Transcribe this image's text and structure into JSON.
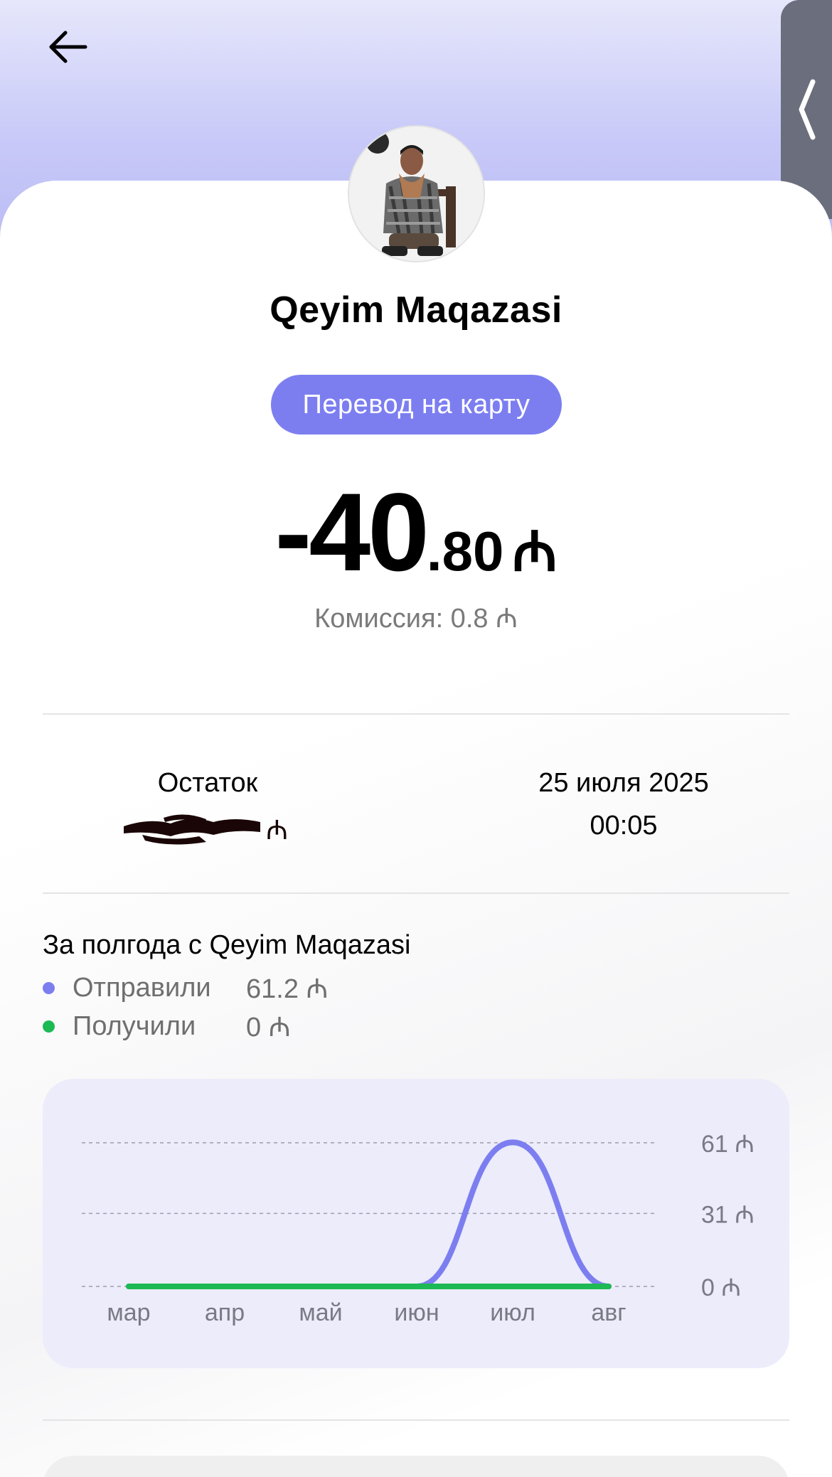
{
  "header": {
    "back_icon": "arrow-left-icon",
    "side_tab_icon": "chevron-left-icon"
  },
  "transaction": {
    "merchant_name": "Qeyim Maqazasi",
    "type_label": "Перевод на карту",
    "amount_main": "-40",
    "amount_cents": ".80",
    "currency": "₼",
    "commission": "Комиссия: 0.8 ₼"
  },
  "details": {
    "balance_label": "Остаток",
    "balance_currency": "₼",
    "date": "25 июля 2025",
    "time": "00:05"
  },
  "summary": {
    "title": "За полгода с Qeyim Maqazasi",
    "sent_label": "Отправили",
    "sent_value": "61.2 ₼",
    "received_label": "Получили",
    "received_value": "0 ₼"
  },
  "colors": {
    "accent": "#7c7ef0",
    "sent_line": "#7c7ef0",
    "received_line": "#1db954",
    "chart_bg": "#ececfb"
  },
  "chart_data": {
    "type": "line",
    "categories": [
      "мар",
      "апр",
      "май",
      "июн",
      "июл",
      "авг"
    ],
    "series": [
      {
        "name": "Отправили",
        "values": [
          0,
          0,
          0,
          0,
          61.2,
          0
        ]
      },
      {
        "name": "Получили",
        "values": [
          0,
          0,
          0,
          0,
          0,
          0
        ]
      }
    ],
    "y_ticks": [
      0,
      31,
      61
    ],
    "y_tick_labels": [
      "0 ₼",
      "31 ₼",
      "61 ₼"
    ],
    "ylim": [
      0,
      61
    ],
    "grid": true
  }
}
